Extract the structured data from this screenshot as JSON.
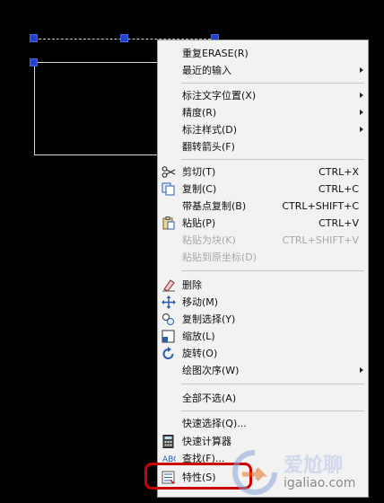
{
  "menu": {
    "items": [
      {
        "label": "重复ERASE(R)",
        "shortcut": "",
        "submenu": false,
        "disabled": false,
        "icon": ""
      },
      {
        "label": "最近的输入",
        "shortcut": "",
        "submenu": true,
        "disabled": false,
        "icon": ""
      },
      {
        "label": "标注文字位置(X)",
        "shortcut": "",
        "submenu": true,
        "disabled": false,
        "icon": ""
      },
      {
        "label": "精度(R)",
        "shortcut": "",
        "submenu": true,
        "disabled": false,
        "icon": ""
      },
      {
        "label": "标注样式(D)",
        "shortcut": "",
        "submenu": true,
        "disabled": false,
        "icon": ""
      },
      {
        "label": "翻转箭头(F)",
        "shortcut": "",
        "submenu": false,
        "disabled": false,
        "icon": ""
      },
      {
        "label": "剪切(T)",
        "shortcut": "CTRL+X",
        "submenu": false,
        "disabled": false,
        "icon": "scissors-icon"
      },
      {
        "label": "复制(C)",
        "shortcut": "CTRL+C",
        "submenu": false,
        "disabled": false,
        "icon": "copy-icon"
      },
      {
        "label": "带基点复制(B)",
        "shortcut": "CTRL+SHIFT+C",
        "submenu": false,
        "disabled": false,
        "icon": ""
      },
      {
        "label": "粘贴(P)",
        "shortcut": "CTRL+V",
        "submenu": false,
        "disabled": false,
        "icon": "paste-icon"
      },
      {
        "label": "粘贴为块(K)",
        "shortcut": "CTRL+SHIFT+V",
        "submenu": false,
        "disabled": true,
        "icon": ""
      },
      {
        "label": "粘贴到原坐标(D)",
        "shortcut": "",
        "submenu": false,
        "disabled": true,
        "icon": ""
      },
      {
        "label": "删除",
        "shortcut": "",
        "submenu": false,
        "disabled": false,
        "icon": "eraser-icon"
      },
      {
        "label": "移动(M)",
        "shortcut": "",
        "submenu": false,
        "disabled": false,
        "icon": "move-icon"
      },
      {
        "label": "复制选择(Y)",
        "shortcut": "",
        "submenu": false,
        "disabled": false,
        "icon": "copy-selection-icon"
      },
      {
        "label": "缩放(L)",
        "shortcut": "",
        "submenu": false,
        "disabled": false,
        "icon": "scale-icon"
      },
      {
        "label": "旋转(O)",
        "shortcut": "",
        "submenu": false,
        "disabled": false,
        "icon": "rotate-icon"
      },
      {
        "label": "绘图次序(W)",
        "shortcut": "",
        "submenu": true,
        "disabled": false,
        "icon": ""
      },
      {
        "label": "全部不选(A)",
        "shortcut": "",
        "submenu": false,
        "disabled": false,
        "icon": ""
      },
      {
        "label": "快速选择(Q)...",
        "shortcut": "",
        "submenu": false,
        "disabled": false,
        "icon": ""
      },
      {
        "label": "快速计算器",
        "shortcut": "",
        "submenu": false,
        "disabled": false,
        "icon": "calculator-icon"
      },
      {
        "label": "查找(F)...",
        "shortcut": "",
        "submenu": false,
        "disabled": false,
        "icon": "find-icon"
      },
      {
        "label": "特性(S)",
        "shortcut": "",
        "submenu": false,
        "disabled": false,
        "icon": "properties-icon"
      }
    ]
  },
  "watermark": {
    "brand": "爱尬聊",
    "url": "igaliao.com"
  },
  "colors": {
    "grip": "#2244cc",
    "highlight": "#cc0000"
  }
}
